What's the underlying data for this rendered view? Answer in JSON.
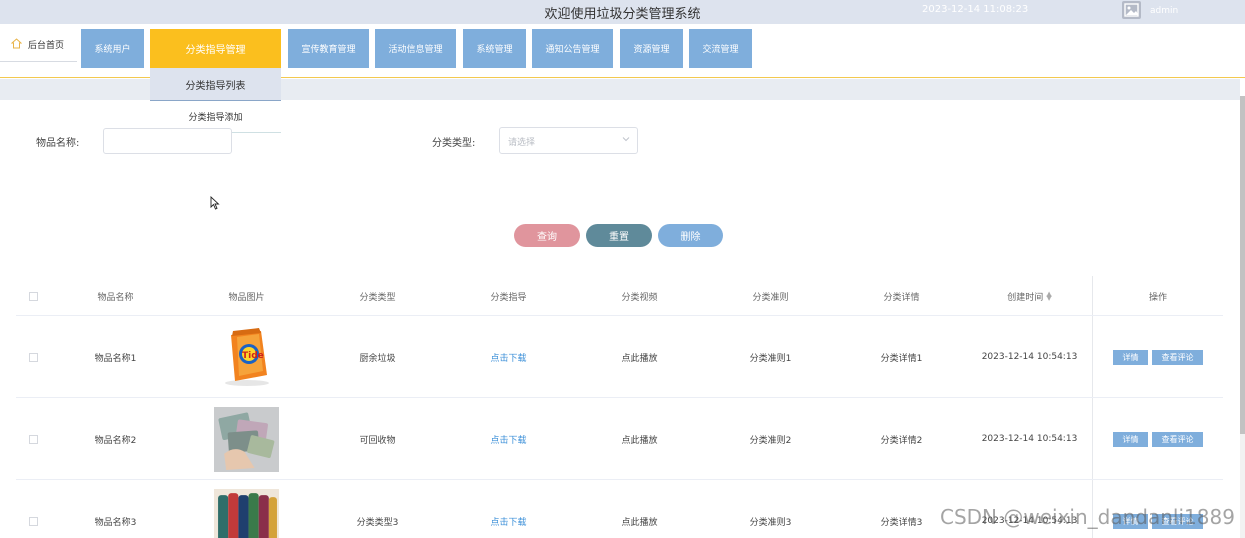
{
  "header": {
    "title": "欢迎使用垃圾分类管理系统",
    "datetime": "2023-12-14 11:08:23",
    "username": "admin"
  },
  "nav": {
    "home_label": "后台首页",
    "items": [
      {
        "label": "系统用户"
      },
      {
        "label": "分类指导管理"
      },
      {
        "label": "宣传教育管理"
      },
      {
        "label": "活动信息管理"
      },
      {
        "label": "系统管理"
      },
      {
        "label": "通知公告管理"
      },
      {
        "label": "资源管理"
      },
      {
        "label": "交流管理"
      }
    ],
    "dropdown": [
      {
        "label": "分类指导列表"
      },
      {
        "label": "分类指导添加"
      }
    ]
  },
  "search": {
    "name_label": "物品名称:",
    "name_value": "",
    "type_label": "分类类型:",
    "type_placeholder": "请选择"
  },
  "buttons": {
    "query": "查询",
    "reset": "重置",
    "delete": "删除"
  },
  "table": {
    "columns": [
      "物品名称",
      "物品图片",
      "分类类型",
      "分类指导",
      "分类视频",
      "分类准则",
      "分类详情",
      "创建时间",
      "操作"
    ],
    "rows": [
      {
        "name": "物品名称1",
        "type": "厨余垃圾",
        "guide": "点击下载",
        "video": "点此播放",
        "rule": "分类准则1",
        "detail": "分类详情1",
        "created": "2023-12-14 10:54:13",
        "op_detail": "详情",
        "op_comment": "查看评论"
      },
      {
        "name": "物品名称2",
        "type": "可回收物",
        "guide": "点击下载",
        "video": "点此播放",
        "rule": "分类准则2",
        "detail": "分类详情2",
        "created": "2023-12-14 10:54:13",
        "op_detail": "详情",
        "op_comment": "查看评论"
      },
      {
        "name": "物品名称3",
        "type": "分类类型3",
        "guide": "点击下载",
        "video": "点此播放",
        "rule": "分类准则3",
        "detail": "分类详情3",
        "created": "2023-12-14 10:54:13",
        "op_detail": "详情",
        "op_comment": "查看评论"
      }
    ]
  },
  "watermark": "CSDN @weixin_dandanli1889",
  "colors": {
    "nav_blue": "#7faedc",
    "nav_active": "#fbbf1e",
    "btn_query": "#e0959d",
    "btn_reset": "#5f8a9a",
    "btn_delete": "#7faedc",
    "link": "#3b8fd8"
  }
}
